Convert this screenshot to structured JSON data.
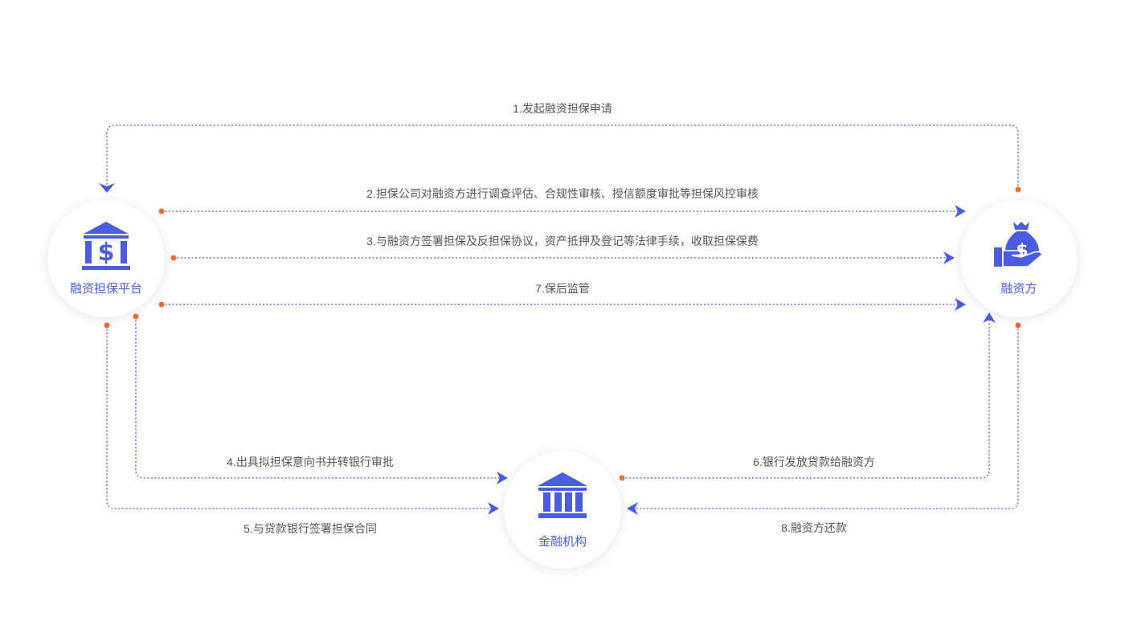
{
  "colors": {
    "primary": "#4a5de0",
    "dot": "#e8703a",
    "text": "#555555"
  },
  "nodes": {
    "platform": {
      "label": "融资担保平台",
      "icon": "bank-dollar-icon"
    },
    "financier": {
      "label": "融资方",
      "icon": "money-bag-hand-icon"
    },
    "institution": {
      "label": "金融机构",
      "icon": "bank-building-icon"
    }
  },
  "steps": {
    "s1": "1.发起融资担保申请",
    "s2": "2.担保公司对融资方进行调查评估、合规性审核、授信额度审批等担保风控审核",
    "s3": "3.与融资方签署担保及反担保协议，资产抵押及登记等法律手续，收取担保保费",
    "s7": "7.保后监管",
    "s4": "4.出具拟担保意向书并转银行审批",
    "s5": "5.与贷款银行签署担保合同",
    "s6": "6.银行发放贷款给融资方",
    "s8": "8.融资方还款"
  }
}
